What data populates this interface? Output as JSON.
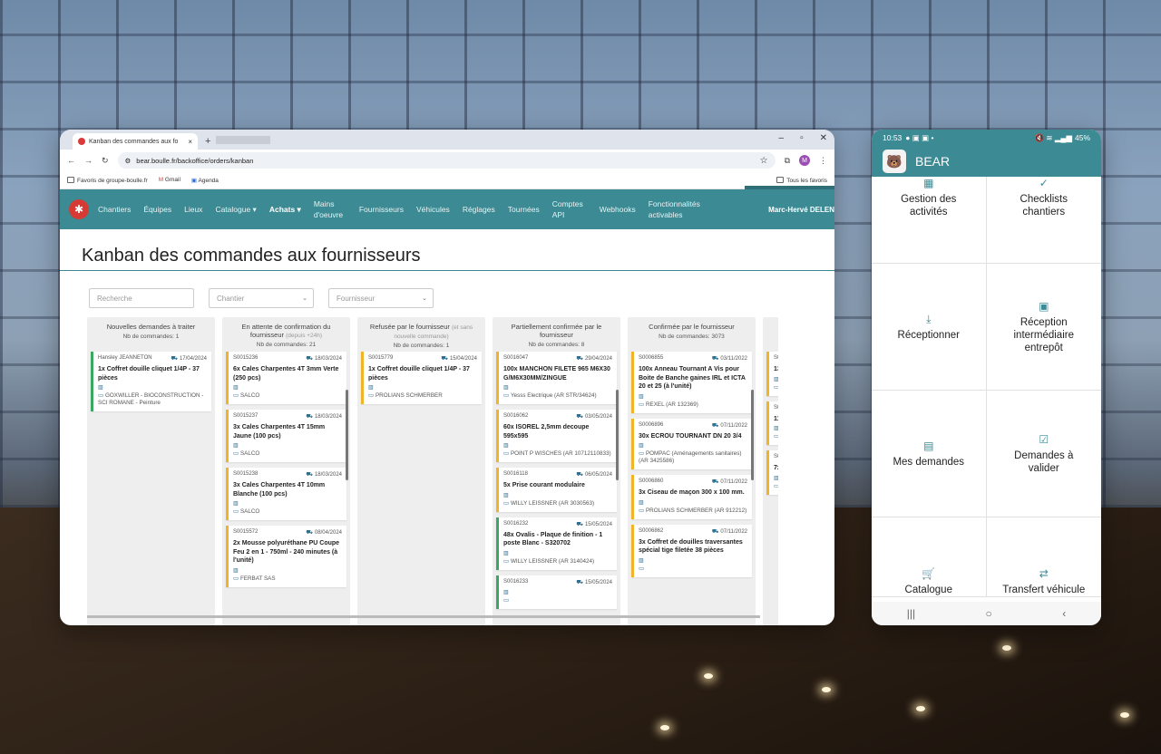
{
  "browser": {
    "tab_title": "Kanban des commandes aux fo",
    "url": "bear.boulle.fr/backoffice/orders/kanban",
    "avatar_letter": "M",
    "bookmarks": [
      "Favoris de groupe-boulle.fr",
      "Gmail",
      "Agenda"
    ],
    "all_bookmarks": "Tous les favoris"
  },
  "nav": {
    "items": [
      "Chantiers",
      "Équipes",
      "Lieux",
      "Catalogue ▾",
      "Achats ▾",
      "Mains d'oeuvre",
      "Fournisseurs",
      "Véhicules",
      "Réglages",
      "Tournées",
      "Comptes API",
      "Webhooks",
      "Fonctionnalités activables"
    ],
    "user": "Marc-Hervé DELEN"
  },
  "page": {
    "title": "Kanban des commandes aux fournisseurs",
    "search_placeholder": "Recherche",
    "chantier_placeholder": "Chantier",
    "fournisseur_placeholder": "Fournisseur"
  },
  "columns": [
    {
      "title": "Nouvelles demandes à traiter",
      "note": "",
      "count": "Nb de commandes: 1",
      "cards": [
        {
          "ref": "Hansley JEANNETON",
          "date": "17/04/2024",
          "title": "1x Coffret douille cliquet 1/4P - 37 pièces",
          "supplier": "GOXWILLER - BIOCONSTRUCTION - SCI ROMANE - Peinture",
          "color": "green"
        }
      ]
    },
    {
      "title": "En attente de confirmation du fournisseur",
      "note": "(depuis +24h)",
      "count": "Nb de commandes: 21",
      "cards": [
        {
          "ref": "S0015236",
          "date": "18/03/2024",
          "title": "6x Cales Charpentes 4T 3mm Verte (250 pcs)",
          "supplier": "SALCO",
          "color": "yellow"
        },
        {
          "ref": "S0015237",
          "date": "18/03/2024",
          "title": "3x Cales Charpentes 4T 15mm Jaune (100 pcs)",
          "supplier": "SALCO",
          "color": "yellow"
        },
        {
          "ref": "S0015238",
          "date": "18/03/2024",
          "title": "3x Cales Charpentes 4T 10mm Blanche (100 pcs)",
          "supplier": "SALCO",
          "color": "yellow"
        },
        {
          "ref": "S0015572",
          "date": "08/04/2024",
          "title": "2x Mousse polyuréthane PU Coupe Feu 2 en 1 - 750ml - 240 minutes (à l'unité)",
          "supplier": "FERBAT SAS",
          "color": "yellow"
        }
      ]
    },
    {
      "title": "Refusée par le fournisseur",
      "note": "(et sans nouvelle commande)",
      "count": "Nb de commandes: 1",
      "cards": [
        {
          "ref": "S0015779",
          "date": "15/04/2024",
          "title": "1x Coffret douille cliquet 1/4P - 37 pièces",
          "supplier": "PROLIANS SCHMERBER",
          "color": "yellow"
        }
      ]
    },
    {
      "title": "Partiellement confirmée par le fournisseur",
      "note": "",
      "count": "Nb de commandes: 8",
      "cards": [
        {
          "ref": "S0016047",
          "date": "29/04/2024",
          "title": "100x MANCHON FILETE 965 M6X30 G/M6X30MM/ZINGUE",
          "supplier": "Yesss Electrique (AR STR/34624)",
          "color": "yellow"
        },
        {
          "ref": "S0016062",
          "date": "03/05/2024",
          "title": "60x ISOREL 2,5mm decoupe 595x595",
          "supplier": "POINT P WISCHES (AR 10712110833)",
          "color": "yellow"
        },
        {
          "ref": "S0016118",
          "date": "06/05/2024",
          "title": "5x Prise courant modulaire",
          "supplier": "WILLY LEISSNER (AR 3030563)",
          "color": "yellow"
        },
        {
          "ref": "S0016232",
          "date": "15/05/2024",
          "title": "48x Ovalis - Plaque de finition - 1 poste Blanc - S320702",
          "supplier": "WILLY LEISSNER (AR 3140424)",
          "color": "green"
        },
        {
          "ref": "S0016233",
          "date": "15/05/2024",
          "title": "",
          "supplier": "",
          "color": "green"
        }
      ]
    },
    {
      "title": "Confirmée par le fournisseur",
      "note": "",
      "count": "Nb de commandes: 3073",
      "cards": [
        {
          "ref": "S0006855",
          "date": "03/11/2022",
          "title": "100x Anneau Tournant A Vis pour Boite de Banche gaines IRL et ICTA 20 et 25 (à l'unité)",
          "supplier": "REXEL (AR 132369)",
          "color": "yellow"
        },
        {
          "ref": "S0006896",
          "date": "07/11/2022",
          "title": "30x ECROU TOURNANT DN 20 3/4",
          "supplier": "POMPAC (Aménagements sanitaires) (AR 3425586)",
          "color": "yellow"
        },
        {
          "ref": "S0006860",
          "date": "07/11/2022",
          "title": "3x Ciseau de maçon 300 x 100 mm.",
          "supplier": "PROLIANS SCHMERBER (AR 912212)",
          "color": "yellow"
        },
        {
          "ref": "S0006862",
          "date": "07/11/2022",
          "title": "3x Coffret de douilles traversantes spécial tige filetée 38 pièces",
          "supplier": "",
          "color": "yellow"
        }
      ]
    },
    {
      "title": "Liv",
      "note": "",
      "count": "N",
      "cards": [
        {
          "ref": "S0015216",
          "date": "",
          "title": "138x Ova 2 postes - Blanc -",
          "supplier": "REXEL",
          "color": "yellow"
        },
        {
          "ref": "S0015214",
          "date": "",
          "title": "116x Oval postes H mm - Bla",
          "supplier": "REXEL",
          "color": "yellow"
        },
        {
          "ref": "S0015445",
          "date": "",
          "title": "7x Prise étanche anthracit OXXO",
          "supplier": "SIEHR",
          "color": "yellow"
        }
      ]
    }
  ],
  "phone": {
    "time": "10:53",
    "battery": "45%",
    "app_name": "BEAR",
    "tiles": [
      {
        "label": "Gestion des activités",
        "icon": "building-icon",
        "glyph": "▦"
      },
      {
        "label": "Checklists chantiers",
        "icon": "check-icon",
        "glyph": "✓"
      },
      {
        "label": "Réceptionner",
        "icon": "download-icon",
        "glyph": "⤓"
      },
      {
        "label": "Réception intermédiaire entrepôt",
        "icon": "archive-icon",
        "glyph": "▣"
      },
      {
        "label": "Mes demandes",
        "icon": "newspaper-icon",
        "glyph": "▤"
      },
      {
        "label": "Demandes à valider",
        "icon": "checkbox-icon",
        "glyph": "☑"
      },
      {
        "label": "Catalogue",
        "icon": "cart-icon",
        "glyph": "🛒"
      },
      {
        "label": "Transfert véhicule",
        "icon": "swap-icon",
        "glyph": "⇄"
      }
    ]
  }
}
